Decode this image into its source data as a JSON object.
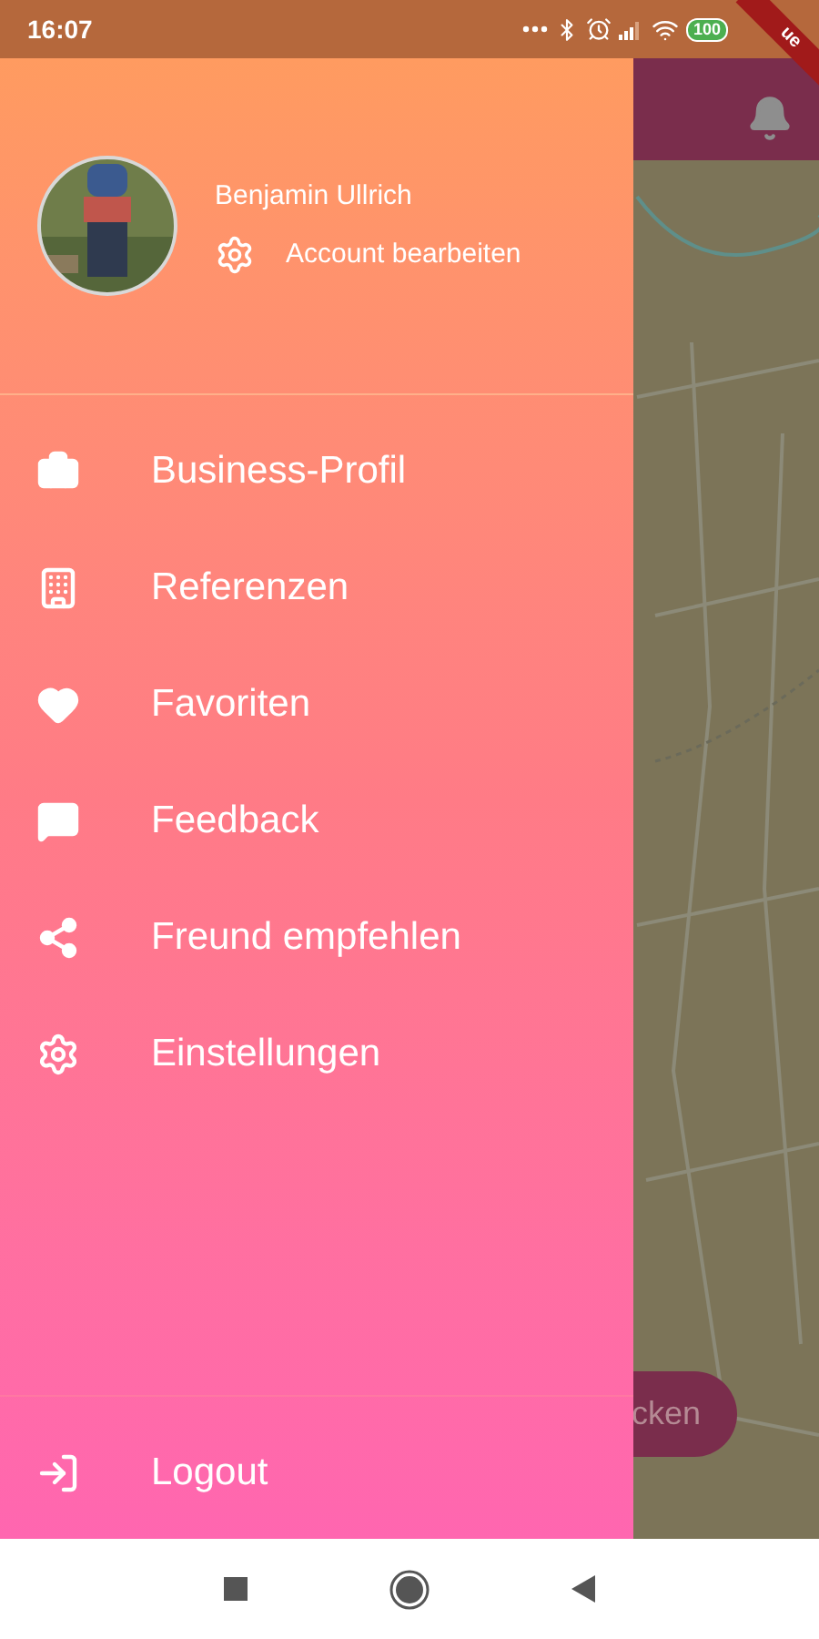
{
  "status_bar": {
    "time": "16:07",
    "battery": "100"
  },
  "debug_banner": {
    "text": "ue"
  },
  "drawer": {
    "header": {
      "name": "Benjamin Ullrich",
      "account_link": "Account bearbeiten"
    },
    "items": [
      {
        "kind": "briefcase",
        "label": "Business-Profil"
      },
      {
        "kind": "building",
        "label": "Referenzen"
      },
      {
        "kind": "heart",
        "label": "Favoriten"
      },
      {
        "kind": "feedback",
        "label": "Feedback"
      },
      {
        "kind": "share",
        "label": "Freund empfehlen"
      },
      {
        "kind": "settings",
        "label": "Einstellungen"
      }
    ],
    "footer_item": {
      "kind": "logout",
      "label": "Logout"
    }
  },
  "background_app": {
    "button": "cken"
  }
}
